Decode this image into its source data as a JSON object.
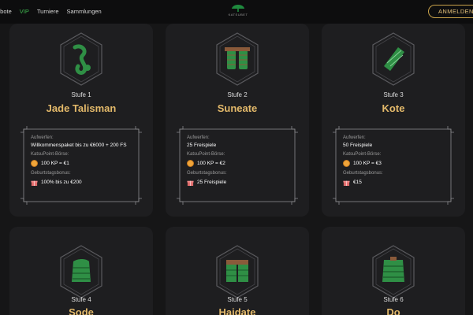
{
  "nav": {
    "items": [
      {
        "label": "ebote",
        "active": false
      },
      {
        "label": "VIP",
        "active": true
      },
      {
        "label": "Turniere",
        "active": false
      },
      {
        "label": "Sammlungen",
        "active": false
      }
    ]
  },
  "logo_text": "KATSUBET",
  "login_label": "ANMELDEN",
  "colors": {
    "accent_gold": "#e3b96a",
    "accent_green": "#3fb950",
    "card_bg": "#1e1e20",
    "page_bg": "#161617"
  },
  "levels": [
    {
      "level": "Stufe 1",
      "name": "Jade Talisman",
      "icon": "jade-talisman-icon",
      "benefits": {
        "gift_label": "Aufwerfen:",
        "gift_value": "Willkommenspaket bis zu €6000 + 200 FS",
        "exchange_label": "KatsuPoint-Börse:",
        "exchange_value": "100 KP = €1",
        "birthday_label": "Geburtstagsbonus:",
        "birthday_value": "100% bis zu €200"
      }
    },
    {
      "level": "Stufe 2",
      "name": "Suneate",
      "icon": "suneate-armor-icon",
      "benefits": {
        "gift_label": "Aufwerfen:",
        "gift_value": "25 Freispiele",
        "exchange_label": "KatsuPoint-Börse:",
        "exchange_value": "100 KP = €2",
        "birthday_label": "Geburtstagsbonus:",
        "birthday_value": "25 Freispiele"
      }
    },
    {
      "level": "Stufe 3",
      "name": "Kote",
      "icon": "kote-armor-icon",
      "benefits": {
        "gift_label": "Aufwerfen:",
        "gift_value": "50 Freispiele",
        "exchange_label": "KatsuPoint-Börse:",
        "exchange_value": "100 KP = €3",
        "birthday_label": "Geburtstagsbonus:",
        "birthday_value": "€15"
      }
    },
    {
      "level": "Stufe 4",
      "name": "Sode",
      "icon": "sode-armor-icon"
    },
    {
      "level": "Stufe 5",
      "name": "Haidate",
      "icon": "haidate-armor-icon"
    },
    {
      "level": "Stufe 6",
      "name": "Do",
      "icon": "do-armor-icon"
    }
  ]
}
